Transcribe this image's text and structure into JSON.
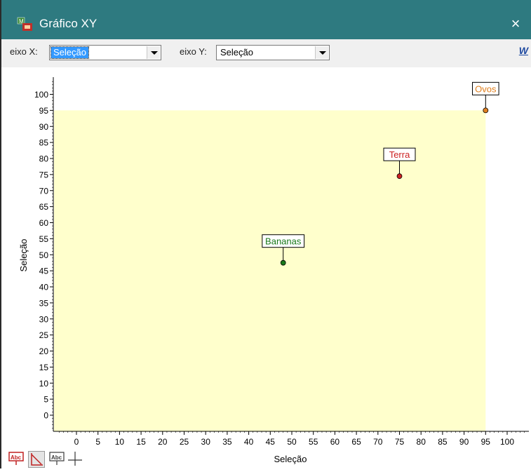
{
  "window": {
    "title": "Gráfico XY",
    "close_label": "×"
  },
  "toolbar": {
    "x_axis_label": "eixo X:",
    "x_axis_value": "Seleção",
    "y_axis_label": "eixo Y:",
    "y_axis_value": "Seleção",
    "w_button_label": "W"
  },
  "chart_data": {
    "type": "scatter",
    "xlabel": "Seleção",
    "ylabel": "Seleção",
    "xlim": [
      -5,
      105
    ],
    "ylim": [
      -5,
      105
    ],
    "xticks": [
      0,
      5,
      10,
      15,
      20,
      25,
      30,
      35,
      40,
      45,
      50,
      55,
      60,
      65,
      70,
      75,
      80,
      85,
      90,
      95,
      100
    ],
    "yticks": [
      0,
      5,
      10,
      15,
      20,
      25,
      30,
      35,
      40,
      45,
      50,
      55,
      60,
      65,
      70,
      75,
      80,
      85,
      90,
      95,
      100
    ],
    "background_region": {
      "x": [
        -5,
        95
      ],
      "y": [
        -5,
        95
      ],
      "color": "#ffffcc"
    },
    "points": [
      {
        "label": "Bananas",
        "x": 48,
        "y": 47.5,
        "color": "#1a7a1a"
      },
      {
        "label": "Terra",
        "x": 75,
        "y": 74.5,
        "color": "#cc2222"
      },
      {
        "label": "Ovos",
        "x": 95,
        "y": 95,
        "color": "#e08020"
      }
    ]
  }
}
